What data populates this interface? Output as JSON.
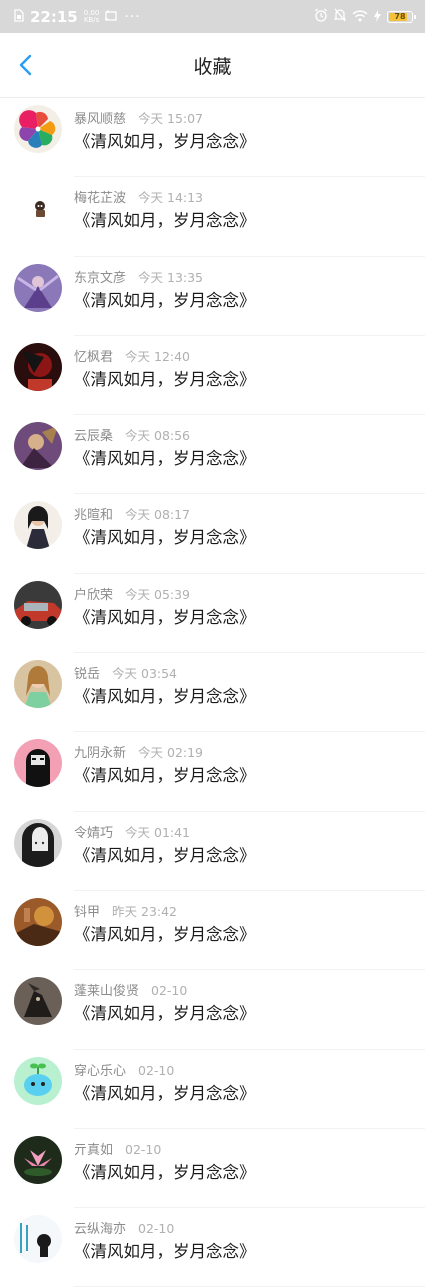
{
  "status_bar": {
    "time": "22:15",
    "speed_value": "0.00",
    "speed_unit": "KB/s",
    "more": "···",
    "battery": "78"
  },
  "header": {
    "title": "收藏"
  },
  "favorites": [
    {
      "name": "暴风顺慈",
      "time": "今天 15:07",
      "text": "《清风如月，岁月念念》"
    },
    {
      "name": "梅花芷波",
      "time": "今天 14:13",
      "text": "《清风如月，岁月念念》"
    },
    {
      "name": "东京文彦",
      "time": "今天 13:35",
      "text": "《清风如月，岁月念念》"
    },
    {
      "name": "忆枫君",
      "time": "今天 12:40",
      "text": "《清风如月，岁月念念》"
    },
    {
      "name": "云辰桑",
      "time": "今天 08:56",
      "text": "《清风如月，岁月念念》"
    },
    {
      "name": "兆暄和",
      "time": "今天 08:17",
      "text": "《清风如月，岁月念念》"
    },
    {
      "name": "户欣荣",
      "time": "今天 05:39",
      "text": "《清风如月，岁月念念》"
    },
    {
      "name": "锐岳",
      "time": "今天 03:54",
      "text": "《清风如月，岁月念念》"
    },
    {
      "name": "九阴永新",
      "time": "今天 02:19",
      "text": "《清风如月，岁月念念》"
    },
    {
      "name": "令婧巧",
      "time": "今天 01:41",
      "text": "《清风如月，岁月念念》"
    },
    {
      "name": "钭甲",
      "time": "昨天 23:42",
      "text": "《清风如月，岁月念念》"
    },
    {
      "name": "蓬莱山俊贤",
      "time": "02-10",
      "text": "《清风如月，岁月念念》"
    },
    {
      "name": "穿心乐心",
      "time": "02-10",
      "text": "《清风如月，岁月念念》"
    },
    {
      "name": "亓真如",
      "time": "02-10",
      "text": "《清风如月，岁月念念》"
    },
    {
      "name": "云纵海亦",
      "time": "02-10",
      "text": "《清风如月，岁月念念》"
    }
  ],
  "colors": {
    "accent": "#2a9df4",
    "status_bar": "#d8d8d8",
    "battery": "#f3c13a"
  }
}
